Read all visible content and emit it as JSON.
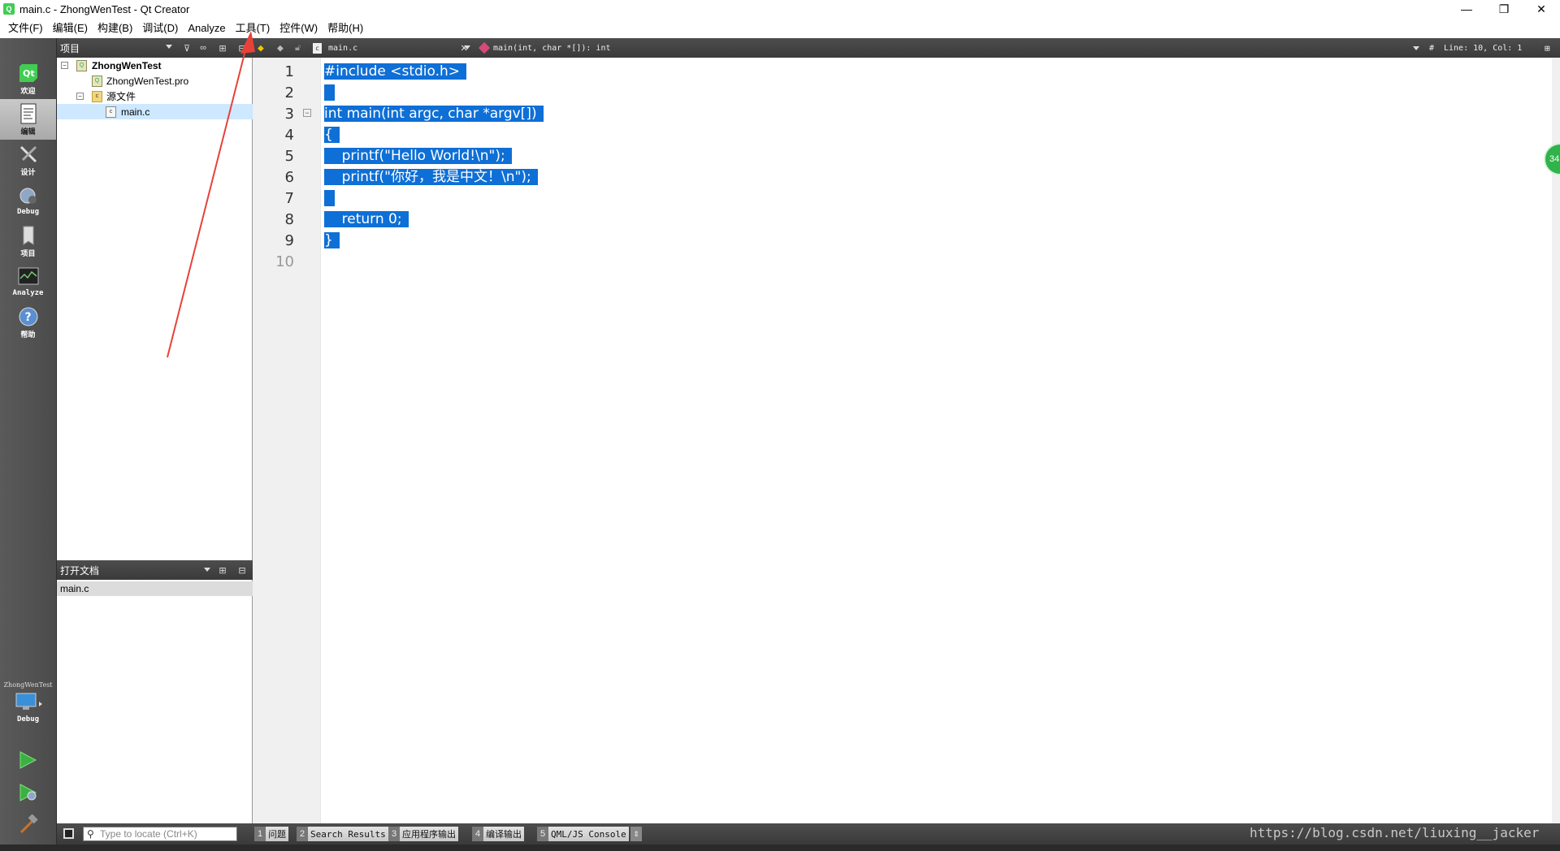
{
  "window": {
    "title": "main.c - ZhongWenTest - Qt Creator",
    "controls": [
      "—",
      "❐",
      "✕"
    ]
  },
  "menubar": [
    "文件(F)",
    "编辑(E)",
    "构建(B)",
    "调试(D)",
    "Analyze",
    "工具(T)",
    "控件(W)",
    "帮助(H)"
  ],
  "modes": [
    {
      "label": "欢迎",
      "icon": "qt-logo-icon",
      "active": false
    },
    {
      "label": "编辑",
      "icon": "edit-document-icon",
      "active": true
    },
    {
      "label": "设计",
      "icon": "design-tools-icon",
      "active": false
    },
    {
      "label": "Debug",
      "icon": "debug-bug-icon",
      "active": false
    },
    {
      "label": "项目",
      "icon": "project-wrench-icon",
      "active": false
    },
    {
      "label": "Analyze",
      "icon": "analyze-monitor-icon",
      "active": false
    },
    {
      "label": "帮助",
      "icon": "help-icon",
      "active": false
    }
  ],
  "kit": {
    "project": "ZhongWenTest",
    "config": "Debug"
  },
  "project_panel": {
    "title": "项目",
    "tree": [
      {
        "label": "ZhongWenTest",
        "bold": true
      },
      {
        "label": "ZhongWenTest.pro"
      },
      {
        "label": "源文件"
      },
      {
        "label": "main.c",
        "selected": true
      }
    ]
  },
  "open_docs": {
    "title": "打开文档",
    "items": [
      "main.c"
    ]
  },
  "editor_toolbar": {
    "file": "main.c",
    "symbol": "main(int, char *[]): int",
    "position": "Line: 10, Col: 1",
    "hash": "#"
  },
  "code": {
    "line_numbers": [
      "1",
      "2",
      "3",
      "4",
      "5",
      "6",
      "7",
      "8",
      "9",
      "10"
    ],
    "lines": [
      "#include <stdio.h>",
      " ",
      "int main(int argc, char *argv[])",
      "{",
      "    printf(\"Hello World!\\n\");",
      "    printf(\"你好，我是中文！\\n\");",
      " ",
      "    return 0;",
      "}"
    ]
  },
  "side_bubble": "34",
  "bottombar": {
    "locator_placeholder": "Type to locate (Ctrl+K)",
    "panes": [
      {
        "num": "1",
        "label": "问题"
      },
      {
        "num": "2",
        "label": "Search Results"
      },
      {
        "num": "3",
        "label": "应用程序输出"
      },
      {
        "num": "4",
        "label": "编译输出"
      },
      {
        "num": "5",
        "label": "QML/JS Console"
      }
    ]
  },
  "watermark": "https://blog.csdn.net/liuxing__jacker",
  "colors": {
    "selection": "#0e6fd6",
    "annotation_arrow": "#e8413a",
    "run_green": "#3cb043"
  }
}
